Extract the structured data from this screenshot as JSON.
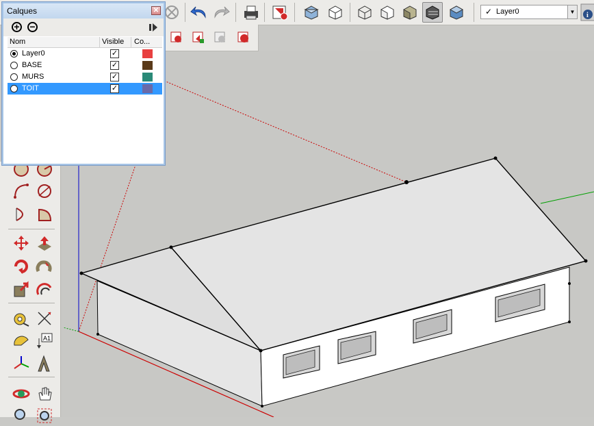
{
  "toolbar": {
    "layer_dropdown": {
      "check": "✓",
      "value": "Layer0"
    }
  },
  "layers_panel": {
    "title": "Calques",
    "close_glyph": "✕",
    "add_glyph": "+",
    "remove_glyph": "−",
    "columns": {
      "name": "Nom",
      "visible": "Visible",
      "color": "Co..."
    },
    "check_glyph": "✓",
    "rows": [
      {
        "name": "Layer0",
        "active": true,
        "visible": true,
        "color": "#e84040",
        "selected": false
      },
      {
        "name": "BASE",
        "active": false,
        "visible": true,
        "color": "#5a3a1a",
        "selected": false
      },
      {
        "name": "MURS",
        "active": false,
        "visible": true,
        "color": "#2a8a78",
        "selected": false
      },
      {
        "name": "TOIT",
        "active": false,
        "visible": true,
        "color": "#6a6aa8",
        "selected": true
      }
    ]
  },
  "colors": {
    "sky": "#c8c8c5",
    "roof": "#e2e2e2",
    "wall": "#ffffff",
    "axis_red": "#cc0000",
    "axis_green": "#00a000",
    "axis_blue": "#0000cc"
  }
}
